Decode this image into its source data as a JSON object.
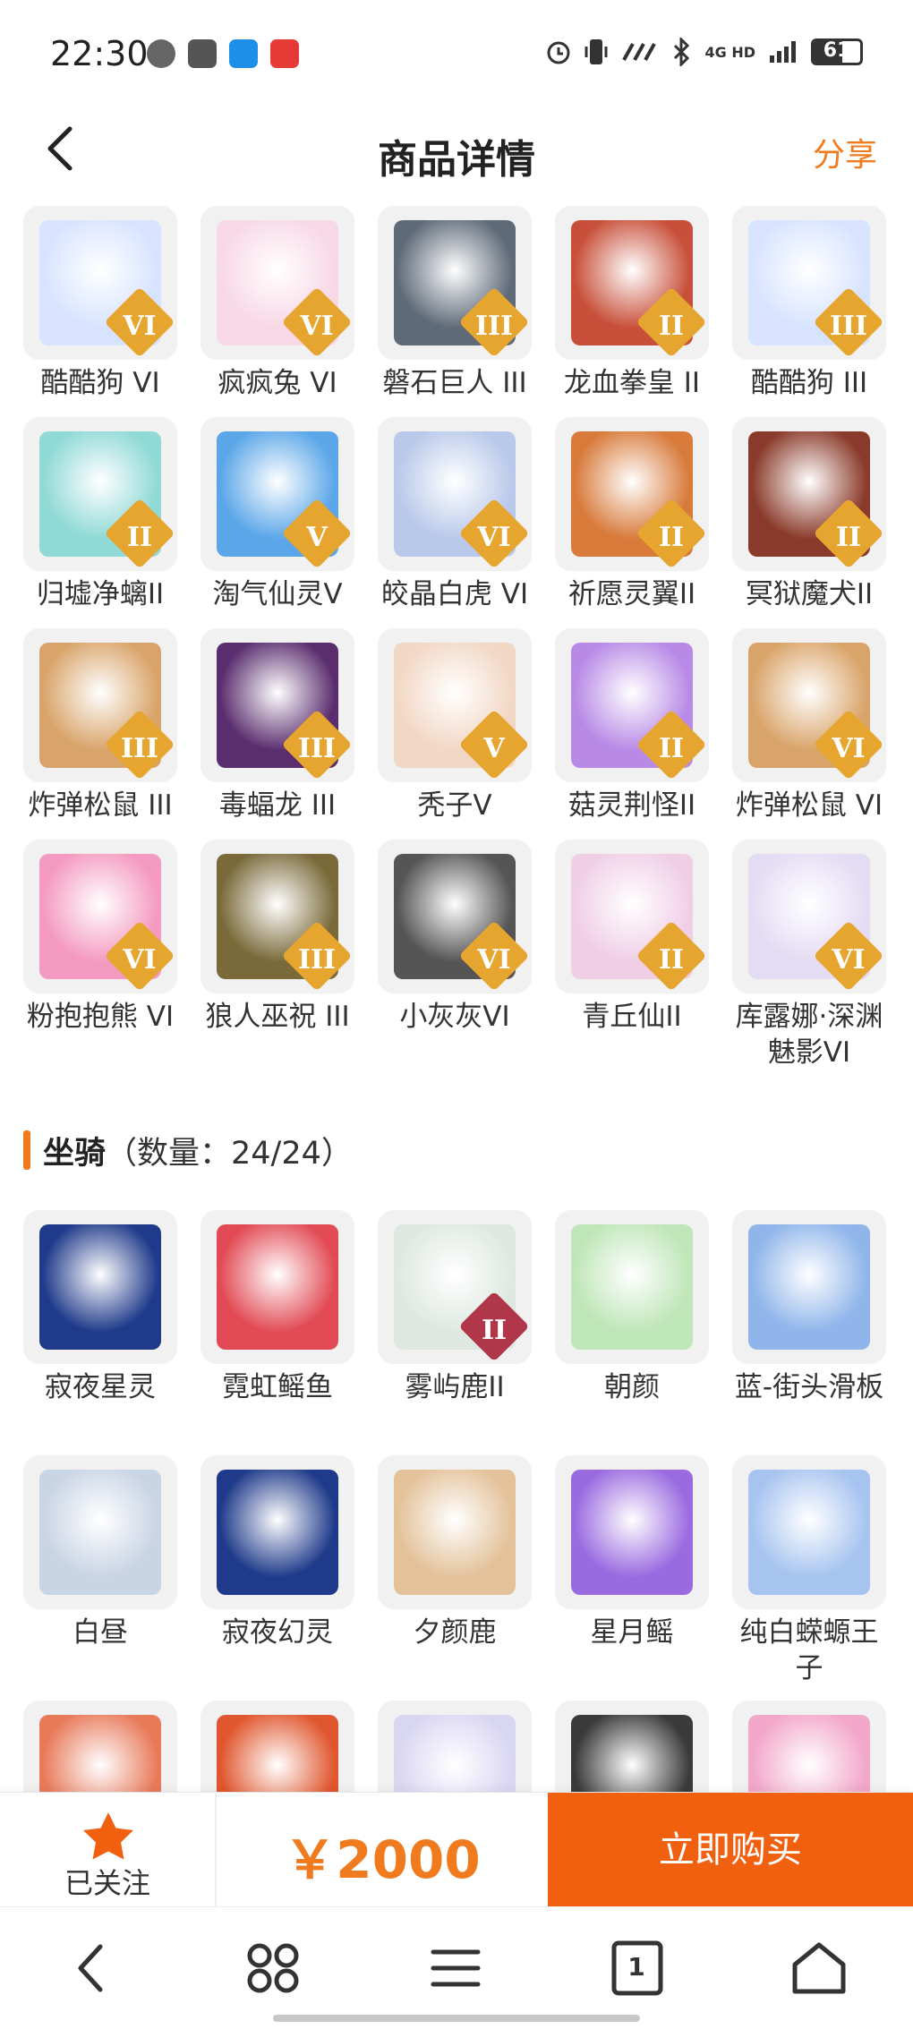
{
  "status_bar": {
    "time": "22:30",
    "network": "4G HD",
    "battery": "61",
    "battery_level": 0.61
  },
  "header": {
    "back_icon": "chevron-left-icon",
    "title": "商品详情",
    "share_label": "分享"
  },
  "skins": [
    {
      "name": "酷酷狗 VI",
      "badge": "VI",
      "color": "#d7e3ff",
      "badge_color": "#e6a52e"
    },
    {
      "name": "疯疯兔 VI",
      "badge": "VI",
      "color": "#f8d8e6",
      "badge_color": "#e6a52e"
    },
    {
      "name": "磐石巨人 III",
      "badge": "III",
      "color": "#5f6a78",
      "badge_color": "#e6a52e"
    },
    {
      "name": "龙血拳皇 II",
      "badge": "II",
      "color": "#c8503a",
      "badge_color": "#e6a52e"
    },
    {
      "name": "酷酷狗 III",
      "badge": "III",
      "color": "#d7e3ff",
      "badge_color": "#e6a52e"
    },
    {
      "name": "归墟净螭II",
      "badge": "II",
      "color": "#8fd9d6",
      "badge_color": "#e6a52e"
    },
    {
      "name": "淘气仙灵V",
      "badge": "V",
      "color": "#5aa6e8",
      "badge_color": "#e6a52e"
    },
    {
      "name": "皎晶白虎 VI",
      "badge": "VI",
      "color": "#b9c9ea",
      "badge_color": "#e6a52e"
    },
    {
      "name": "祈愿灵翼II",
      "badge": "II",
      "color": "#d87a3a",
      "badge_color": "#e6a52e"
    },
    {
      "name": "冥狱魔犬II",
      "badge": "II",
      "color": "#8a3a2a",
      "badge_color": "#e6a52e"
    },
    {
      "name": "炸弹松鼠 III",
      "badge": "III",
      "color": "#d9a46a",
      "badge_color": "#e6a52e"
    },
    {
      "name": "毒蝠龙 III",
      "badge": "III",
      "color": "#5a2d6e",
      "badge_color": "#e6a52e"
    },
    {
      "name": "秃子V",
      "badge": "V",
      "color": "#f2d7c4",
      "badge_color": "#e6a52e"
    },
    {
      "name": "菇灵荆怪II",
      "badge": "II",
      "color": "#b88ae6",
      "badge_color": "#e6a52e"
    },
    {
      "name": "炸弹松鼠 VI",
      "badge": "VI",
      "color": "#d9a46a",
      "badge_color": "#e6a52e"
    },
    {
      "name": "粉抱抱熊 VI",
      "badge": "VI",
      "color": "#f49ac0",
      "badge_color": "#e6a52e"
    },
    {
      "name": "狼人巫祝 III",
      "badge": "III",
      "color": "#7a6a3a",
      "badge_color": "#e6a52e"
    },
    {
      "name": "小灰灰VI",
      "badge": "VI",
      "color": "#555555",
      "badge_color": "#e6a52e"
    },
    {
      "name": "青丘仙II",
      "badge": "II",
      "color": "#f0cfe6",
      "badge_color": "#e6a52e"
    },
    {
      "name": "库露娜·深渊魅影VI",
      "badge": "VI",
      "color": "#e4dcf4",
      "badge_color": "#e6a52e"
    }
  ],
  "mounts_section": {
    "title": "坐骑",
    "count": "（数量：24/24）"
  },
  "mounts": [
    {
      "name": "寂夜星灵",
      "badge": "",
      "color": "#1f3a8a"
    },
    {
      "name": "霓虹鳐鱼",
      "badge": "",
      "color": "#e24b55"
    },
    {
      "name": "雾屿鹿II",
      "badge": "II",
      "color": "#dfe8e0",
      "badge_color": "#b0374a"
    },
    {
      "name": "朝颜",
      "badge": "",
      "color": "#bfe6b8"
    },
    {
      "name": "蓝-街头滑板",
      "badge": "",
      "color": "#8fb5ea"
    },
    {
      "name": "白昼",
      "badge": "",
      "color": "#c9d4e4"
    },
    {
      "name": "寂夜幻灵",
      "badge": "",
      "color": "#1f3a8a"
    },
    {
      "name": "夕颜鹿",
      "badge": "",
      "color": "#e3c29a"
    },
    {
      "name": "星月鳐",
      "badge": "",
      "color": "#9a6ae0"
    },
    {
      "name": "纯白蝾螈王子",
      "badge": "",
      "color": "#a7c4f0"
    },
    {
      "name": "",
      "badge": "",
      "color": "#e87a5a"
    },
    {
      "name": "",
      "badge": "",
      "color": "#e0562e"
    },
    {
      "name": "",
      "badge": "",
      "color": "#d9d6f2"
    },
    {
      "name": "",
      "badge": "",
      "color": "#3a3a3a"
    },
    {
      "name": "",
      "badge": "",
      "color": "#f2a6c8"
    }
  ],
  "action_bar": {
    "follow_label": "已关注",
    "price": "￥2000",
    "buy_label": "立即购买"
  },
  "nav_bar": {
    "tab_count": "1"
  },
  "colors": {
    "accent": "#f07b1e",
    "buy_button": "#f0600f"
  }
}
